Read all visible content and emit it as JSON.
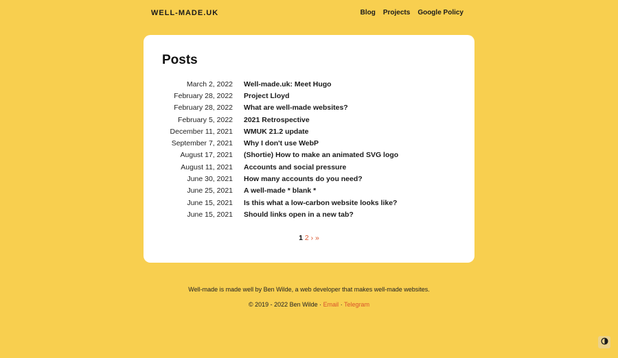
{
  "header": {
    "site_title": "WELL-MADE.UK",
    "nav": [
      "Blog",
      "Projects",
      "Google Policy"
    ]
  },
  "main": {
    "title": "Posts",
    "posts": [
      {
        "date": "March 2, 2022",
        "title": "Well-made.uk: Meet Hugo"
      },
      {
        "date": "February 28, 2022",
        "title": "Project Lloyd"
      },
      {
        "date": "February 28, 2022",
        "title": "What are well-made websites?"
      },
      {
        "date": "February 5, 2022",
        "title": "2021 Retrospective"
      },
      {
        "date": "December 11, 2021",
        "title": "WMUK 21.2 update"
      },
      {
        "date": "September 7, 2021",
        "title": "Why I don't use WebP"
      },
      {
        "date": "August 17, 2021",
        "title": "(Shortie) How to make an animated SVG logo"
      },
      {
        "date": "August 11, 2021",
        "title": "Accounts and social pressure"
      },
      {
        "date": "June 30, 2021",
        "title": "How many accounts do you need?"
      },
      {
        "date": "June 25, 2021",
        "title": "A well-made * blank *"
      },
      {
        "date": "June 15, 2021",
        "title": "Is this what a low-carbon website looks like?"
      },
      {
        "date": "June 15, 2021",
        "title": "Should links open in a new tab?"
      }
    ],
    "pagination": {
      "current": "1",
      "next_page": "2",
      "next": "›",
      "last": "»"
    }
  },
  "footer": {
    "tagline": "Well-made is made well by Ben Wilde, a web developer that makes well-made websites.",
    "copyright": "© 2019 - 2022 Ben Wilde",
    "separator": "·",
    "email": "Email",
    "telegram": "Telegram"
  },
  "theme_toggle": {
    "icon": "contrast-icon"
  },
  "colors": {
    "background": "#f8cf4f",
    "card": "#ffffff",
    "accent": "#d9532b"
  }
}
